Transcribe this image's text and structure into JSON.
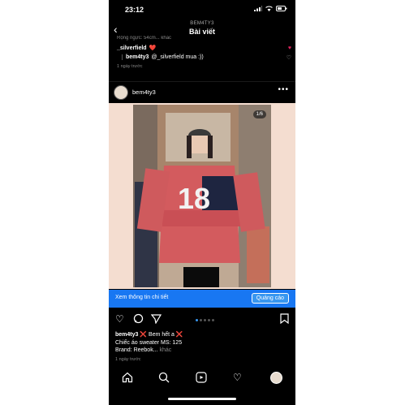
{
  "status": {
    "time": "23:12"
  },
  "nav": {
    "username": "BEM4TY3",
    "title": "Bài viết",
    "back": "‹"
  },
  "comments": {
    "cut_text": "Rộng ngực: 54cm... khác",
    "first": {
      "user": "_silverfield",
      "emoji": "❤️"
    },
    "reply": {
      "user": "bem4ty3",
      "text": "@_silverfield mua :))"
    },
    "time": "1 ngày trước"
  },
  "post": {
    "username": "bem4ty3",
    "more": "•••",
    "counter": "1/6",
    "cta_text": "Xem thông tin chi tiết",
    "cta_button": "Quảng cáo",
    "caption": {
      "user": "bem4ty3",
      "line1": "❌ Bem hết a ❌",
      "line2": "Chiếc áo sweater MS: 125",
      "line3": "Brand: Reebok...",
      "more": "khác",
      "time": "1 ngày trước"
    },
    "jersey_number": "18"
  },
  "icons": {
    "like": "heart-icon",
    "comment": "comment-icon",
    "share": "share-icon",
    "save": "bookmark-icon",
    "home": "home-icon",
    "search": "search-icon",
    "reels": "reels-icon",
    "activity": "heart-icon",
    "profile": "avatar"
  },
  "colors": {
    "cta": "#1877f2",
    "like_red": "#e0245e",
    "page_dot_active": "#3897f0"
  }
}
